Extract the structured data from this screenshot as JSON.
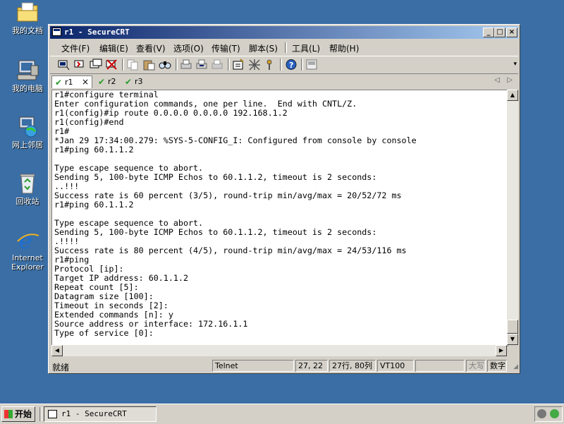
{
  "desktop": {
    "icons": [
      {
        "label": "我的文档"
      },
      {
        "label": "我的电脑"
      },
      {
        "label": "网上邻居"
      },
      {
        "label": "回收站"
      },
      {
        "label": "Internet Explorer"
      }
    ]
  },
  "window": {
    "title": "r1 - SecureCRT",
    "controls": {
      "minimize": "_",
      "maximize": "□",
      "close": "×"
    },
    "menu": [
      "文件(F)",
      "编辑(E)",
      "查看(V)",
      "选项(O)",
      "传输(T)",
      "脚本(S)",
      "工具(L)",
      "帮助(H)"
    ],
    "toolbar_icons": [
      "connect-icon",
      "quick-connect-icon",
      "connect-tab-icon",
      "disconnect-icon",
      "copy-icon",
      "paste-icon",
      "find-icon",
      "print-setup-icon",
      "print-selection-icon",
      "print-icon",
      "session-options-icon",
      "global-options-icon",
      "keymap-icon",
      "help-icon",
      "chat-window-icon"
    ],
    "tabs": [
      {
        "label": "r1",
        "close": "×",
        "active": true
      },
      {
        "label": "r2",
        "active": false
      },
      {
        "label": "r3",
        "active": false
      }
    ],
    "tab_nav": {
      "prev": "◁",
      "next": "▷"
    },
    "terminal_lines": [
      "r1#configure terminal",
      "Enter configuration commands, one per line.  End with CNTL/Z.",
      "r1(config)#ip route 0.0.0.0 0.0.0.0 192.168.1.2",
      "r1(config)#end",
      "r1#",
      "*Jan 29 17:34:00.279: %SYS-5-CONFIG_I: Configured from console by console",
      "r1#ping 60.1.1.2",
      "",
      "Type escape sequence to abort.",
      "Sending 5, 100-byte ICMP Echos to 60.1.1.2, timeout is 2 seconds:",
      "..!!!",
      "Success rate is 60 percent (3/5), round-trip min/avg/max = 20/52/72 ms",
      "r1#ping 60.1.1.2",
      "",
      "Type escape sequence to abort.",
      "Sending 5, 100-byte ICMP Echos to 60.1.1.2, timeout is 2 seconds:",
      ".!!!!",
      "Success rate is 80 percent (4/5), round-trip min/avg/max = 24/53/116 ms",
      "r1#ping",
      "Protocol [ip]:",
      "Target IP address: 60.1.1.2",
      "Repeat count [5]:",
      "Datagram size [100]:",
      "Timeout in seconds [2]:",
      "Extended commands [n]: y",
      "Source address or interface: 172.16.1.1",
      "Type of service [0]:"
    ],
    "status": {
      "main": "就绪",
      "protocol": "Telnet",
      "cursor": "27, 22",
      "size": "27行, 80列",
      "emulation": "VT100",
      "caps": "大写",
      "num": "数字"
    }
  },
  "taskbar": {
    "start": "开始",
    "task": "r1 - SecureCRT"
  },
  "colors": {
    "desktop": "#3a6ea5",
    "title_start": "#0a246a",
    "title_end": "#a6caf0",
    "chrome": "#d4d0c8"
  }
}
